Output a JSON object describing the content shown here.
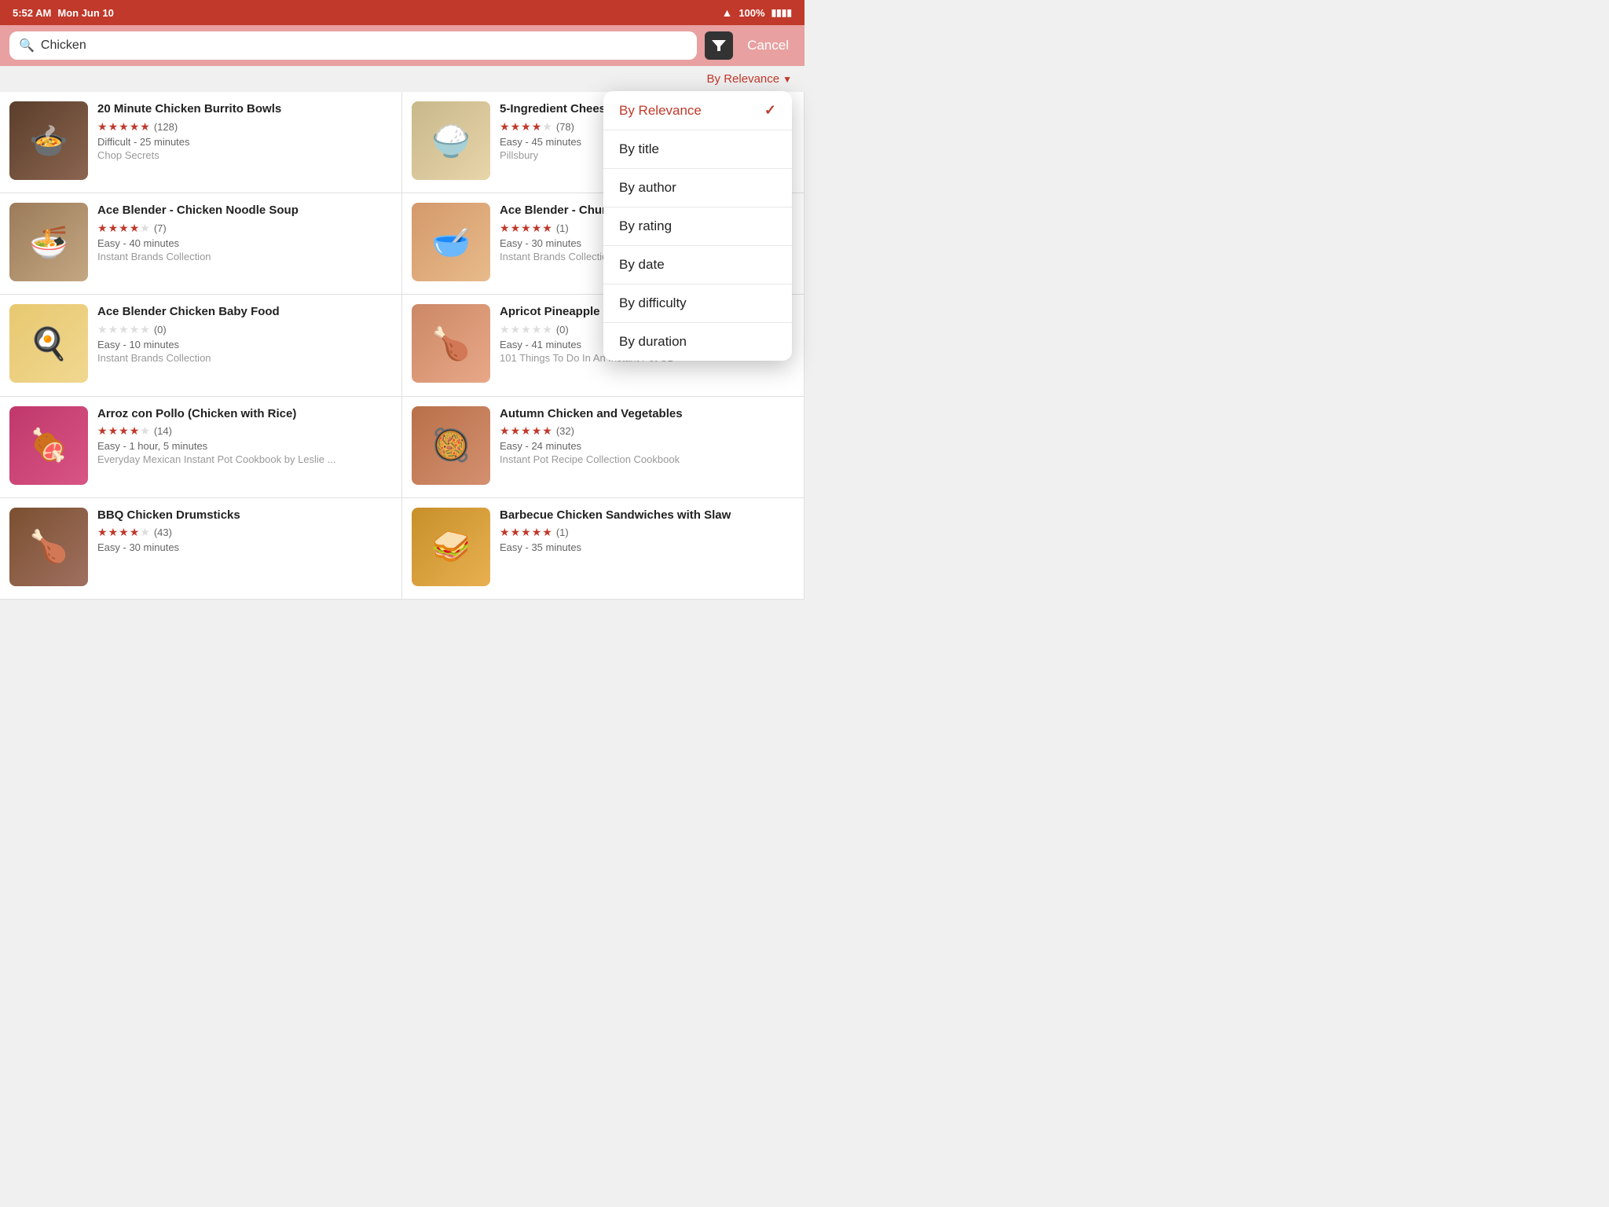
{
  "status_bar": {
    "time": "5:52 AM",
    "day": "Mon Jun 10",
    "battery": "100%"
  },
  "search": {
    "query": "Chicken",
    "placeholder": "Search"
  },
  "filter": {
    "cancel_label": "Cancel"
  },
  "sort": {
    "current_label": "By Relevance",
    "options": [
      {
        "id": "relevance",
        "label": "By Relevance",
        "active": true
      },
      {
        "id": "title",
        "label": "By title",
        "active": false
      },
      {
        "id": "author",
        "label": "By author",
        "active": false
      },
      {
        "id": "rating",
        "label": "By rating",
        "active": false
      },
      {
        "id": "date",
        "label": "By date",
        "active": false
      },
      {
        "id": "difficulty",
        "label": "By difficulty",
        "active": false
      },
      {
        "id": "duration",
        "label": "By duration",
        "active": false
      }
    ]
  },
  "recipes": [
    {
      "id": 1,
      "title": "20 Minute Chicken Burrito Bowls",
      "rating": 5,
      "rating_count": 128,
      "difficulty": "Difficult",
      "duration": "25 minutes",
      "author": "Chop Secrets",
      "thumb_class": "thumb-1",
      "thumb_emoji": "🍲"
    },
    {
      "id": 2,
      "title": "5-Ingredient Cheesy Chicken Broccoli and Rice",
      "rating": 3.5,
      "rating_count": 78,
      "difficulty": "Easy",
      "duration": "45 minutes",
      "author": "Pillsbury",
      "thumb_class": "thumb-2",
      "thumb_emoji": "🍚"
    },
    {
      "id": 3,
      "title": "Ace Blender - Chicken Noodle Soup",
      "rating": 4,
      "rating_count": 7,
      "difficulty": "Easy",
      "duration": "40 minutes",
      "author": "Instant Brands Collection",
      "thumb_class": "thumb-3",
      "thumb_emoji": "🍜"
    },
    {
      "id": 4,
      "title": "Ace Blender - Chunky Chicken Soup",
      "rating": 5,
      "rating_count": 1,
      "difficulty": "Easy",
      "duration": "30 minutes",
      "author": "Instant Brands Collection",
      "thumb_class": "thumb-4",
      "thumb_emoji": "🥣"
    },
    {
      "id": 5,
      "title": "Ace Blender Chicken Baby Food",
      "rating": 0,
      "rating_count": 0,
      "difficulty": "Easy",
      "duration": "10 minutes",
      "author": "Instant Brands Collection",
      "thumb_class": "thumb-5",
      "thumb_emoji": "🍳"
    },
    {
      "id": 6,
      "title": "Apricot Pineapple Chicken",
      "rating": 0,
      "rating_count": 0,
      "difficulty": "Easy",
      "duration": "41 minutes",
      "author": "101 Things To Do In An Instant Pot CB",
      "thumb_class": "thumb-6",
      "thumb_emoji": "🍗"
    },
    {
      "id": 7,
      "title": "Arroz con Pollo (Chicken with Rice)",
      "rating": 4,
      "rating_count": 14,
      "difficulty": "Easy",
      "duration": "1 hour, 5 minutes",
      "author": "Everyday Mexican Instant Pot Cookbook by Leslie ...",
      "thumb_class": "thumb-7",
      "thumb_emoji": "🍖"
    },
    {
      "id": 8,
      "title": "Autumn Chicken and Vegetables",
      "rating": 5,
      "rating_count": 32,
      "difficulty": "Easy",
      "duration": "24 minutes",
      "author": "Instant Pot Recipe Collection Cookbook",
      "thumb_class": "thumb-8",
      "thumb_emoji": "🥘"
    },
    {
      "id": 9,
      "title": "BBQ Chicken Drumsticks",
      "rating": 4,
      "rating_count": 43,
      "difficulty": "Easy",
      "duration": "30 minutes",
      "author": "",
      "thumb_class": "thumb-9",
      "thumb_emoji": "🍗"
    },
    {
      "id": 10,
      "title": "Barbecue Chicken Sandwiches with Slaw",
      "rating": 5,
      "rating_count": 1,
      "difficulty": "Easy",
      "duration": "35 minutes",
      "author": "",
      "thumb_class": "thumb-10",
      "thumb_emoji": "🥪"
    }
  ]
}
